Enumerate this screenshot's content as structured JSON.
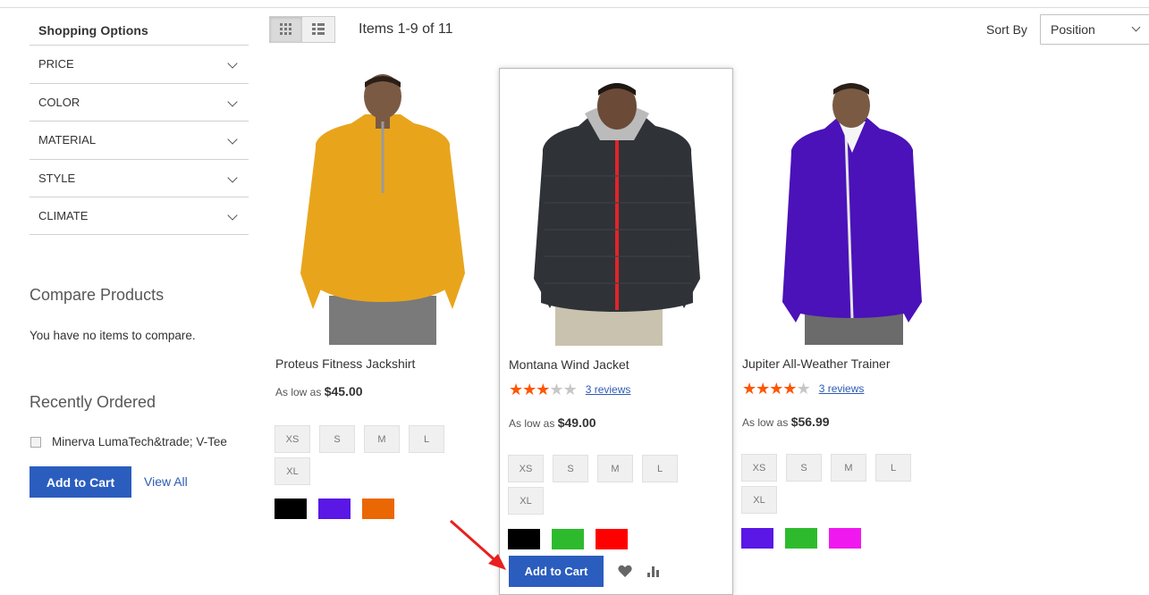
{
  "sidebar": {
    "title": "Shopping Options",
    "filters": [
      "PRICE",
      "COLOR",
      "MATERIAL",
      "STYLE",
      "CLIMATE"
    ],
    "compare_title": "Compare Products",
    "compare_empty": "You have no items to compare.",
    "recent_title": "Recently Ordered",
    "recent_item": "Minerva LumaTech&trade; V-Tee",
    "add_to_cart": "Add to Cart",
    "view_all": "View All"
  },
  "toolbar": {
    "mode_icons": [
      "grid-icon",
      "list-icon"
    ],
    "amount": "Items 1-9 of 11",
    "sort_label": "Sort By",
    "sort_value": "Position"
  },
  "products": [
    {
      "name": "Proteus Fitness Jackshirt",
      "price_prefix": "As low as",
      "price": "$45.00",
      "sizes": [
        "XS",
        "S",
        "M",
        "L",
        "XL"
      ],
      "colors": [
        "#000000",
        "#5a17e6",
        "#eb6703"
      ],
      "jacket_color": "#e8a51c"
    },
    {
      "name": "Montana Wind Jacket",
      "rating_stars": 3,
      "reviews": "3 reviews",
      "price_prefix": "As low as",
      "price": "$49.00",
      "sizes": [
        "XS",
        "S",
        "M",
        "L",
        "XL"
      ],
      "colors": [
        "#000000",
        "#2dbb2d",
        "#ff0000"
      ],
      "jacket_color": "#2f3237",
      "add_to_cart": "Add to Cart"
    },
    {
      "name": "Jupiter All-Weather Trainer",
      "rating_stars": 4,
      "reviews": "3 reviews",
      "price_prefix": "As low as",
      "price": "$56.99",
      "sizes": [
        "XS",
        "S",
        "M",
        "L",
        "XL"
      ],
      "colors": [
        "#5a17e6",
        "#2dbb2d",
        "#ef19ef"
      ],
      "jacket_color": "#4a12b8"
    }
  ],
  "annotation_color": "#e8201f"
}
